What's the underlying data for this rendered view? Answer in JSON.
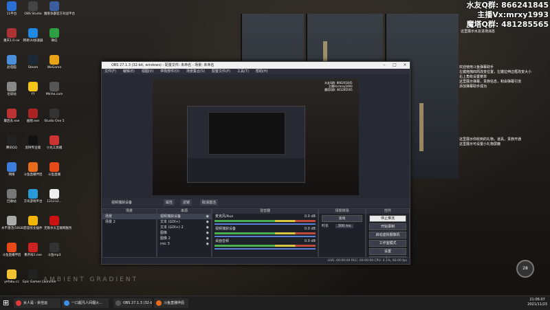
{
  "overlay": {
    "group_fans": "水友Q群: 866241845",
    "anchor_vx": "主播Vx:mrxy1993",
    "tower_group": "魔塔Q群: 481285565",
    "subtitle": "这里展示水友进场消息",
    "chat_top": [
      "欢迎使用斗鱼弹幕助手",
      "左键拖拽四周改变位置，左键拉伸边框改变大小",
      "右上角有设置菜单",
      "这里展示弹幕，贵族信息，和由弹幕引流",
      "添加弹幕助手成功"
    ],
    "chat_bottom": [
      "这里展示你收到的礼物，道具，贵族开通",
      "这里展示可设置小礼物屏蔽"
    ],
    "speed_badge": "28"
  },
  "desktop_icons": [
    {
      "label": "11平台",
      "color": "#2b6fd6"
    },
    {
      "label": "OBS Studio",
      "color": "#444"
    },
    {
      "label": "魔兽争霸官方对战平台",
      "color": "#3c5e9e"
    },
    {
      "label": "重庆1.0.rar",
      "color": "#a33"
    },
    {
      "label": "网易UU加速器",
      "color": "#1e88e5"
    },
    {
      "label": "微信",
      "color": "#2ea043"
    },
    {
      "label": "此电脑",
      "color": "#4a8fd9"
    },
    {
      "label": "Steam",
      "color": "#1b2838"
    },
    {
      "label": "WeGame",
      "color": "#e8a317"
    },
    {
      "label": "垃圾站",
      "color": "#888"
    },
    {
      "label": "YY",
      "color": "#f5c518"
    },
    {
      "label": "99che.com",
      "color": "#555"
    },
    {
      "label": "最后去.exe",
      "color": "#b33"
    },
    {
      "label": "画图.exe",
      "color": "#a22"
    },
    {
      "label": "Studio One 5",
      "color": "#333"
    },
    {
      "label": "腾讯QQ",
      "color": "#222"
    },
    {
      "label": "剪映专业版",
      "color": "#111"
    },
    {
      "label": "小丸工具箱",
      "color": "#c33"
    },
    {
      "label": "网络",
      "color": "#3b7dd8"
    },
    {
      "label": "斗鱼直播伴侣",
      "color": "#e66b1b"
    },
    {
      "label": "斗鱼直播",
      "color": "#e64a19"
    },
    {
      "label": "回收站",
      "color": "#777"
    },
    {
      "label": "方块游戏平台",
      "color": "#2a9ad6"
    },
    {
      "label": "121212...",
      "color": "#eee"
    },
    {
      "label": "水不激活(50GB)",
      "color": "#aaa"
    },
    {
      "label": "音旋优化插件",
      "color": "#f2b705"
    },
    {
      "label": "无限水头互联网服务",
      "color": "#c11"
    },
    {
      "label": "斗鱼直播伴侣",
      "color": "#e64a19"
    },
    {
      "label": "重开局1.exe",
      "color": "#c22"
    },
    {
      "label": "斗鱼mp3",
      "color": "#333"
    },
    {
      "label": "yefabu.cc",
      "color": "#f1c232"
    },
    {
      "label": "Epic Games Launcher",
      "color": "#222"
    }
  ],
  "obs": {
    "title": "OBS 27.1.3 (32-bit, windows) - 配置文件: 未命名 - 场景: 未命名",
    "menu": [
      "文件(F)",
      "编辑(E)",
      "视图(V)",
      "停靠部件(D)",
      "场景集合(S)",
      "配置文件(P)",
      "工具(T)",
      "帮助(H)"
    ],
    "source_bar": {
      "label": "视频捕获设备",
      "props": "属性",
      "filters": "滤镜",
      "device": "取消激活"
    },
    "scenes": {
      "header": "场景",
      "items": [
        "场景",
        "场景 2"
      ]
    },
    "sources": {
      "header": "来源",
      "items": [
        "视频捕获设备",
        "文本 (GDI+)",
        "文本 (GDI+) 2",
        "图像",
        "图像 2",
        "mic 3"
      ]
    },
    "mixer": {
      "header": "混音器",
      "channels": [
        {
          "name": "麦克风/Aux",
          "value": "0.0 dB"
        },
        {
          "name": "视频捕获设备",
          "value": "0.0 dB"
        },
        {
          "name": "桌面音频",
          "value": "0.0 dB"
        }
      ]
    },
    "transitions": {
      "header": "场景转场",
      "type": "淡出",
      "duration_label": "时长",
      "duration": "300 ms"
    },
    "controls": {
      "header": "控件",
      "buttons": [
        "停止推流",
        "开始录制",
        "启动虚拟摄像机",
        "工作室模式",
        "设置",
        "退出"
      ]
    },
    "status": "LIVE: 00:00:00   REC: 00:00:00   CPU: 4.1%, 60.00 fps"
  },
  "watermark": "AMBIENT GRADIENT",
  "taskbar": {
    "items": [
      {
        "label": "女人是 - 余佳运",
        "color": "#e23a3a"
      },
      {
        "label": "一口超凡人间烟火...",
        "color": "#3c8ee8"
      },
      {
        "label": "OBS 27.1.3 (32-bi...",
        "color": "#555"
      },
      {
        "label": "斗鱼直播伴侣",
        "color": "#e66b1b"
      }
    ],
    "time": "21:06:07",
    "date": "2021/11/23"
  }
}
